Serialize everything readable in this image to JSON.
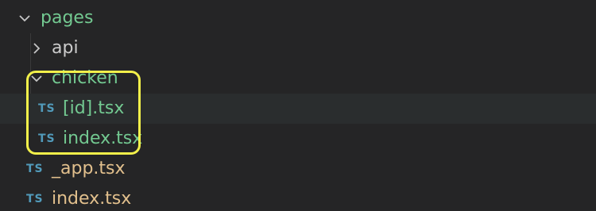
{
  "colors": {
    "background": "#252526",
    "hover_row": "#2a2d2e",
    "folder_label": "#73c991",
    "file_label_green": "#73c991",
    "file_label_yellow": "#e2c08d",
    "api_label": "#cccccc",
    "ts_icon": "#519aba",
    "highlight": "#f2f04a",
    "chevron": "#c5c5c5"
  },
  "tree": {
    "pages": {
      "label": "pages",
      "icon": "chevron-down-icon"
    },
    "api": {
      "label": "api",
      "icon": "chevron-right-icon"
    },
    "chicken": {
      "label": "chicken",
      "icon": "chevron-down-icon"
    },
    "id_file": {
      "label": "[id].tsx",
      "badge": "TS"
    },
    "chicken_index": {
      "label": "index.tsx",
      "badge": "TS"
    },
    "app_file": {
      "label": "_app.tsx",
      "badge": "TS"
    },
    "pages_index": {
      "label": "index.tsx",
      "badge": "TS"
    }
  }
}
